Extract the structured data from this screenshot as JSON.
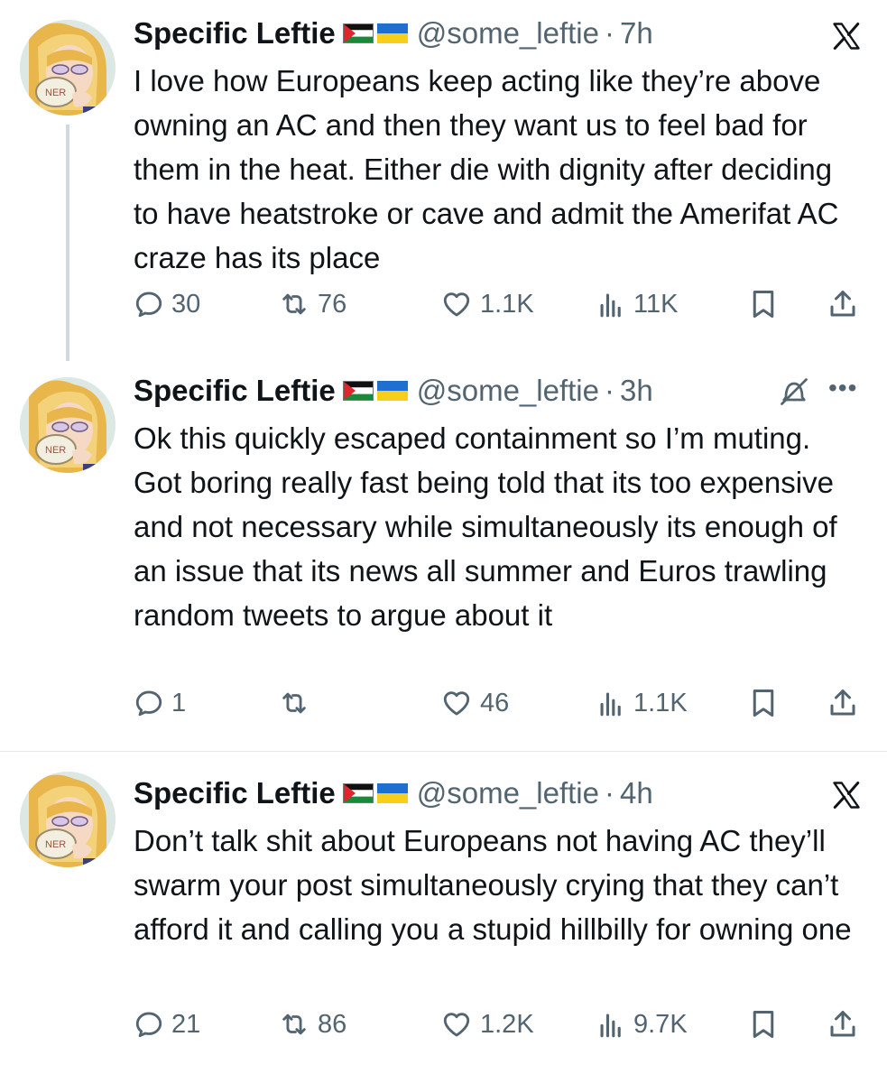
{
  "tweets": [
    {
      "name": "Specific Leftie",
      "handle": "@some_leftie",
      "dot": "·",
      "time": "7h",
      "text": "I love how Europeans keep acting like they’re above owning an AC and then they want us to feel bad for them in the heat. Either die with dignity after deciding to have heatstroke or cave and admit the Amerifat AC craze has its place",
      "replies": "30",
      "reposts": "76",
      "likes": "1.1K",
      "views": "11K",
      "corner_icon": "x-logo-icon"
    },
    {
      "name": "Specific Leftie",
      "handle": "@some_leftie",
      "dot": "·",
      "time": "3h",
      "text": "Ok this quickly escaped containment so I’m muting. Got boring really fast being told that its too expensive and not necessary while simultaneously its enough of an issue that its news all summer and Euros trawling random tweets to argue about it",
      "replies": "1",
      "reposts": "",
      "likes": "46",
      "views": "1.1K",
      "corner_icon": "muted-conversation-icon"
    },
    {
      "name": "Specific Leftie",
      "handle": "@some_leftie",
      "dot": "·",
      "time": "4h",
      "text": "Don’t talk shit about Europeans not having AC they’ll swarm your post simultaneously crying that they can’t afford it and calling you a stupid hillbilly for owning one",
      "replies": "21",
      "reposts": "86",
      "likes": "1.2K",
      "views": "9.7K",
      "corner_icon": "x-logo-icon"
    }
  ],
  "colors": {
    "text": "#0f1419",
    "secondary": "#536471",
    "divider": "#e7e9ea",
    "thread_line": "#cfd9de"
  }
}
